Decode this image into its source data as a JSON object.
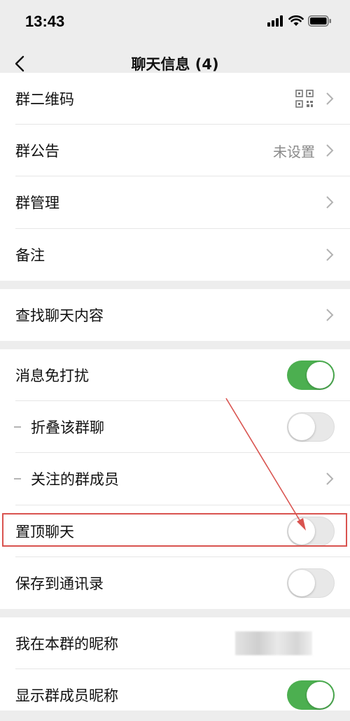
{
  "status_bar": {
    "time": "13:43"
  },
  "nav": {
    "title": "聊天信息 (4)"
  },
  "section1": [
    {
      "label": "群二维码"
    },
    {
      "label": "群公告",
      "value": "未设置"
    },
    {
      "label": "群管理"
    },
    {
      "label": "备注"
    }
  ],
  "section2": [
    {
      "label": "查找聊天内容"
    }
  ],
  "section3": [
    {
      "label": "消息免打扰",
      "toggle": true
    },
    {
      "label": "折叠该群聊",
      "toggle": false
    },
    {
      "label": "关注的群成员"
    },
    {
      "label": "置顶聊天",
      "toggle": false
    },
    {
      "label": "保存到通讯录",
      "toggle": false
    }
  ],
  "section4": [
    {
      "label": "我在本群的昵称"
    },
    {
      "label": "显示群成员昵称",
      "toggle": true
    }
  ],
  "colors": {
    "accent_green": "#4caf50",
    "annotation_red": "#d9534f"
  }
}
